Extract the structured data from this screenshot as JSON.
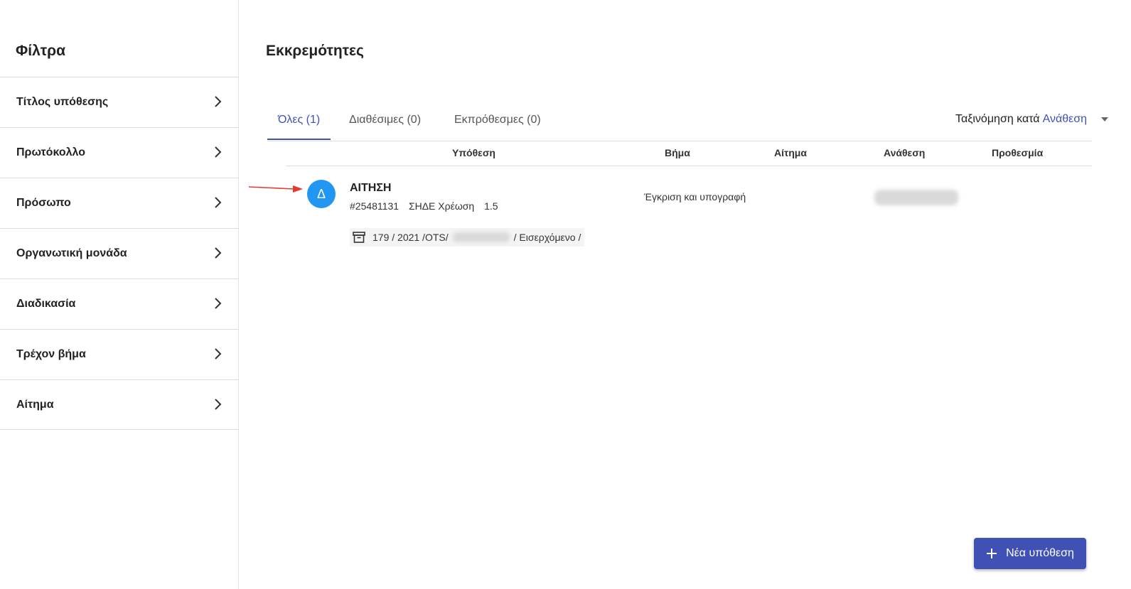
{
  "sidebar": {
    "title": "Φίλτρα",
    "items": [
      {
        "label": "Τίτλος υπόθεσης"
      },
      {
        "label": "Πρωτόκολλο"
      },
      {
        "label": "Πρόσωπο"
      },
      {
        "label": "Οργανωτική μονάδα"
      },
      {
        "label": "Διαδικασία"
      },
      {
        "label": "Τρέχον βήμα"
      },
      {
        "label": "Αίτημα"
      }
    ]
  },
  "main": {
    "title": "Εκκρεμότητες",
    "tabs": [
      {
        "label": "Όλες (1)",
        "active": true
      },
      {
        "label": "Διαθέσιμες (0)",
        "active": false
      },
      {
        "label": "Εκπρόθεσμες (0)",
        "active": false
      }
    ],
    "sort": {
      "label": "Ταξινόμηση κατά",
      "value": "Ανάθεση"
    },
    "columns": {
      "case": "Υπόθεση",
      "step": "Βήμα",
      "request": "Αίτημα",
      "assignment": "Ανάθεση",
      "deadline": "Προθεσμία"
    },
    "rows": [
      {
        "avatar_letter": "Δ",
        "title": "ΑΙΤΗΣΗ",
        "id": "#25481131",
        "type": "ΣΗΔΕ Χρέωση",
        "version": "1.5",
        "step": "Έγκριση και υπογραφή",
        "protocol_prefix": "179 / 2021 /OTS/",
        "protocol_suffix": "/ Εισερχόμενο /"
      }
    ]
  },
  "fab": {
    "label": "Νέα υπόθεση"
  },
  "colors": {
    "accent": "#3f51b5",
    "avatar": "#2196f3",
    "annotation_arrow": "#e53935"
  }
}
